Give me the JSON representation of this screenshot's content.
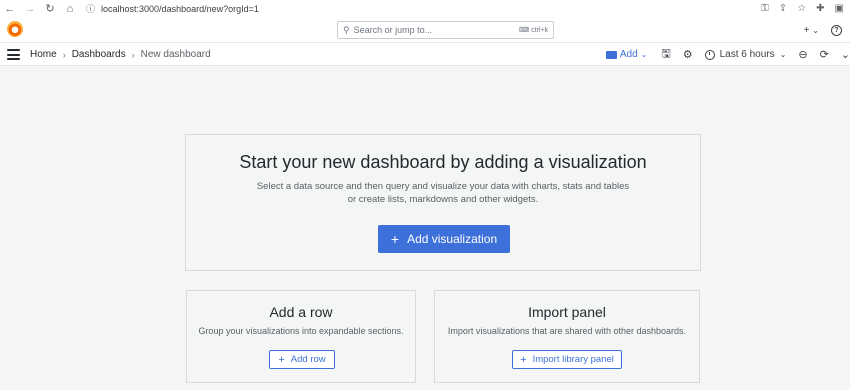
{
  "browser": {
    "url": "localhost:3000/dashboard/new?orgId=1"
  },
  "topnav": {
    "search_placeholder": "Search or jump to...",
    "search_shortcut": "ctrl+k"
  },
  "breadcrumb": {
    "items": [
      "Home",
      "Dashboards",
      "New dashboard"
    ]
  },
  "toolbar": {
    "add_label": "Add",
    "time_range": "Last 6 hours"
  },
  "hero": {
    "title": "Start your new dashboard by adding a visualization",
    "description_line1": "Select a data source and then query and visualize your data with charts, stats and tables",
    "description_line2": "or create lists, markdowns and other widgets.",
    "button_label": "Add visualization"
  },
  "row_card": {
    "title": "Add a row",
    "description": "Group your visualizations into expandable sections.",
    "button_label": "Add row"
  },
  "panel_card": {
    "title": "Import panel",
    "description": "Import visualizations that are shared with other dashboards.",
    "button_label": "Import library panel"
  },
  "colors": {
    "accent": "#3d71d9",
    "background": "#f4f5f5"
  }
}
